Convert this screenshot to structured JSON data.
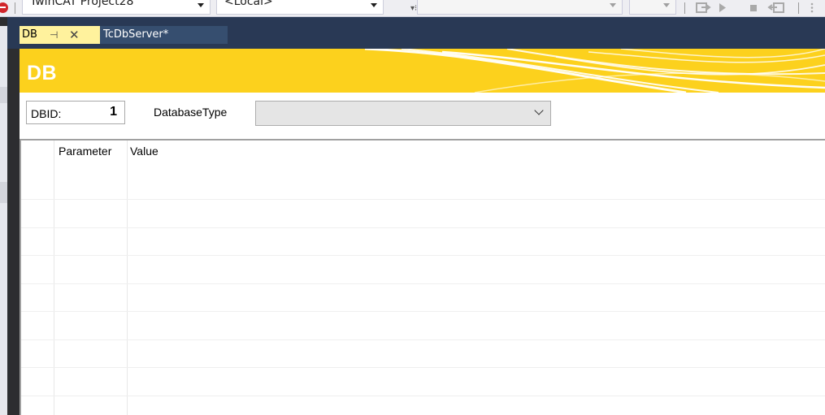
{
  "toolbar": {
    "project_combo": "TwinCAT Project28",
    "target_combo": "<Local>",
    "overflow_glyph": "▾⁝",
    "icons": [
      "step-into-icon",
      "play-icon",
      "stop-icon",
      "step-out-icon",
      "more-icon"
    ]
  },
  "tabs": {
    "active": {
      "label": "DB",
      "pin_glyph": "⊣",
      "close_glyph": "✕"
    },
    "inactive": {
      "label": "TcDbServer*"
    }
  },
  "banner": {
    "title": "DB",
    "color": "#fcd11d"
  },
  "fields": {
    "dbid_label": "DBID:",
    "dbid_value": "1",
    "dbtype_label": "DatabaseType",
    "dbtype_value": ""
  },
  "grid": {
    "columns": [
      "",
      "Parameter",
      "Value"
    ],
    "rows": []
  },
  "colors": {
    "ide_dark": "#293955",
    "tab_active": "#fff29d",
    "tab_inactive": "#364e6f",
    "stop": "#d1262b"
  }
}
